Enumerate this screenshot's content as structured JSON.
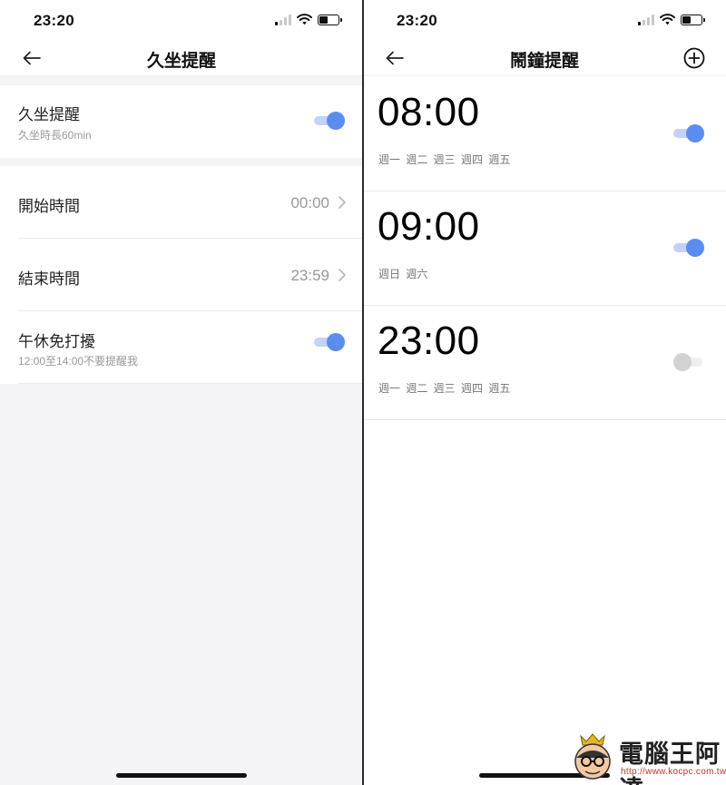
{
  "left": {
    "status_time": "23:20",
    "title": "久坐提醒",
    "sedentary": {
      "label": "久坐提醒",
      "sub": "久坐時長60min",
      "enabled": true
    },
    "start": {
      "label": "開始時間",
      "value": "00:00"
    },
    "end": {
      "label": "結束時間",
      "value": "23:59"
    },
    "nap": {
      "label": "午休免打擾",
      "sub": "12:00至14:00不要提醒我",
      "enabled": true
    }
  },
  "right": {
    "status_time": "23:20",
    "title": "鬧鐘提醒",
    "alarms": [
      {
        "time": "08:00",
        "days": "週一 週二 週三 週四 週五",
        "enabled": true
      },
      {
        "time": "09:00",
        "days": "週日 週六",
        "enabled": true
      },
      {
        "time": "23:00",
        "days": "週一 週二 週三 週四 週五",
        "enabled": false
      }
    ]
  },
  "watermark": {
    "brand": "電腦王阿達",
    "url": "http://www.kocpc.com.tw"
  },
  "colors": {
    "accent": "#5b8def",
    "accent_track": "#c3d2fa",
    "separator": "#ebebeb",
    "group_bg": "#f4f4f6"
  },
  "icons": {
    "back": "arrow-left-icon",
    "chevron": "chevron-right-icon",
    "add": "plus-circle-icon",
    "signal": "cellular-signal-icon",
    "wifi": "wifi-icon",
    "battery": "battery-icon"
  }
}
